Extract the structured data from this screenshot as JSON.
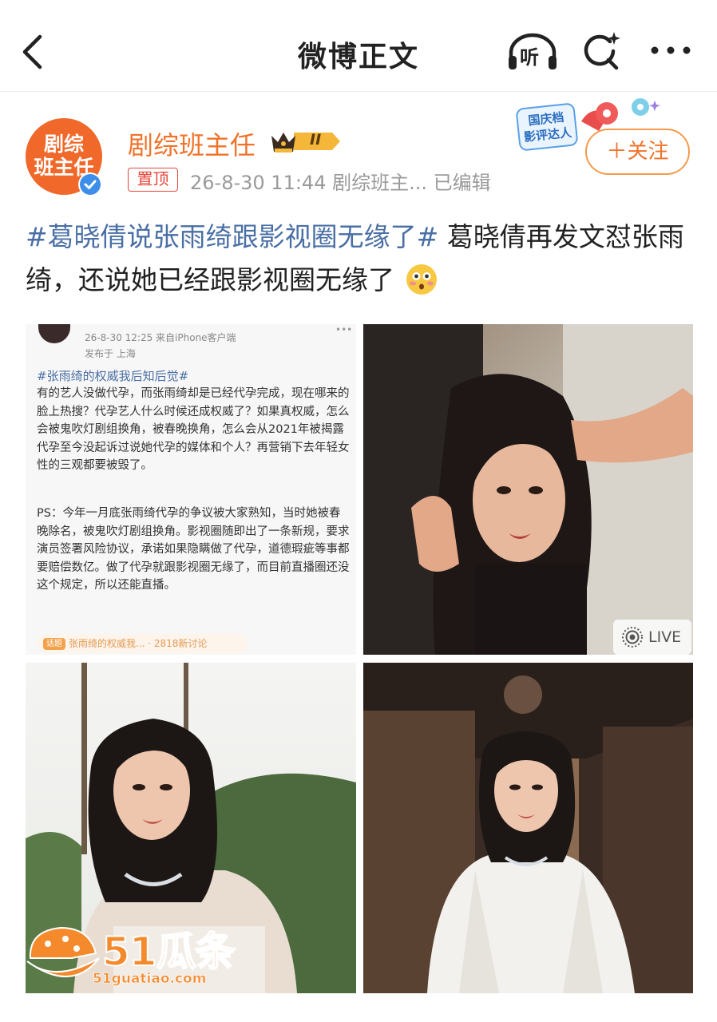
{
  "header": {
    "title": "微博正文",
    "listen_label": "听"
  },
  "author": {
    "avatar_text_line1": "剧综",
    "avatar_text_line2": "班主任",
    "name": "剧综班主任",
    "level_badge": "II",
    "pin_label": "置顶",
    "meta": "26-8-30 11:44  剧综班主...  已编辑",
    "event_badge_line1": "国庆档",
    "event_badge_line2": "影评达人",
    "follow_label": "＋关注"
  },
  "post": {
    "hashtag": "#葛晓倩说张雨绮跟影视圈无缘了#",
    "text": "葛晓倩再发文怼张雨绮，还说她已经跟影视圈无缘了",
    "emoji": "flushed-face-emoji"
  },
  "images": {
    "screenshot": {
      "date": "26-8-30 12:25  来自iPhone客户端",
      "location": "发布于 上海",
      "dots": "•••",
      "hashtag": "#张雨绮的权威我后知后觉#",
      "body": "有的艺人没做代孕，而张雨绮却是已经代孕完成，现在哪来的脸上热搜？代孕艺人什么时候还成权威了？如果真权威，怎么会被鬼吹灯剧组换角，被春晚换角，怎么会从2021年被揭露代孕至今没起诉过说她代孕的媒体和个人？再营销下去年轻女性的三观都要被毁了。",
      "ps": "PS：今年一月底张雨绮代孕的争议被大家熟知，当时她被春晚除名，被鬼吹灯剧组换角。影视圈随即出了一条新规，要求演员签署风险协议，承诺如果隐瞒做了代孕，道德瑕疵等事都要赔偿数亿。做了代孕就跟影视圈无缘了，而目前直播圈还没这个规定，所以还能直播。",
      "chip_tag": "话题",
      "chip_text": "张雨绮的权威我... · 2818新讨论"
    },
    "live_label": "LIVE"
  },
  "watermark": {
    "text": "51瓜条",
    "url": "51guatiao.com"
  },
  "colors": {
    "accent_orange": "#f0732a",
    "hashtag_blue": "#4a6fa5",
    "pin_red": "#e8453a"
  }
}
